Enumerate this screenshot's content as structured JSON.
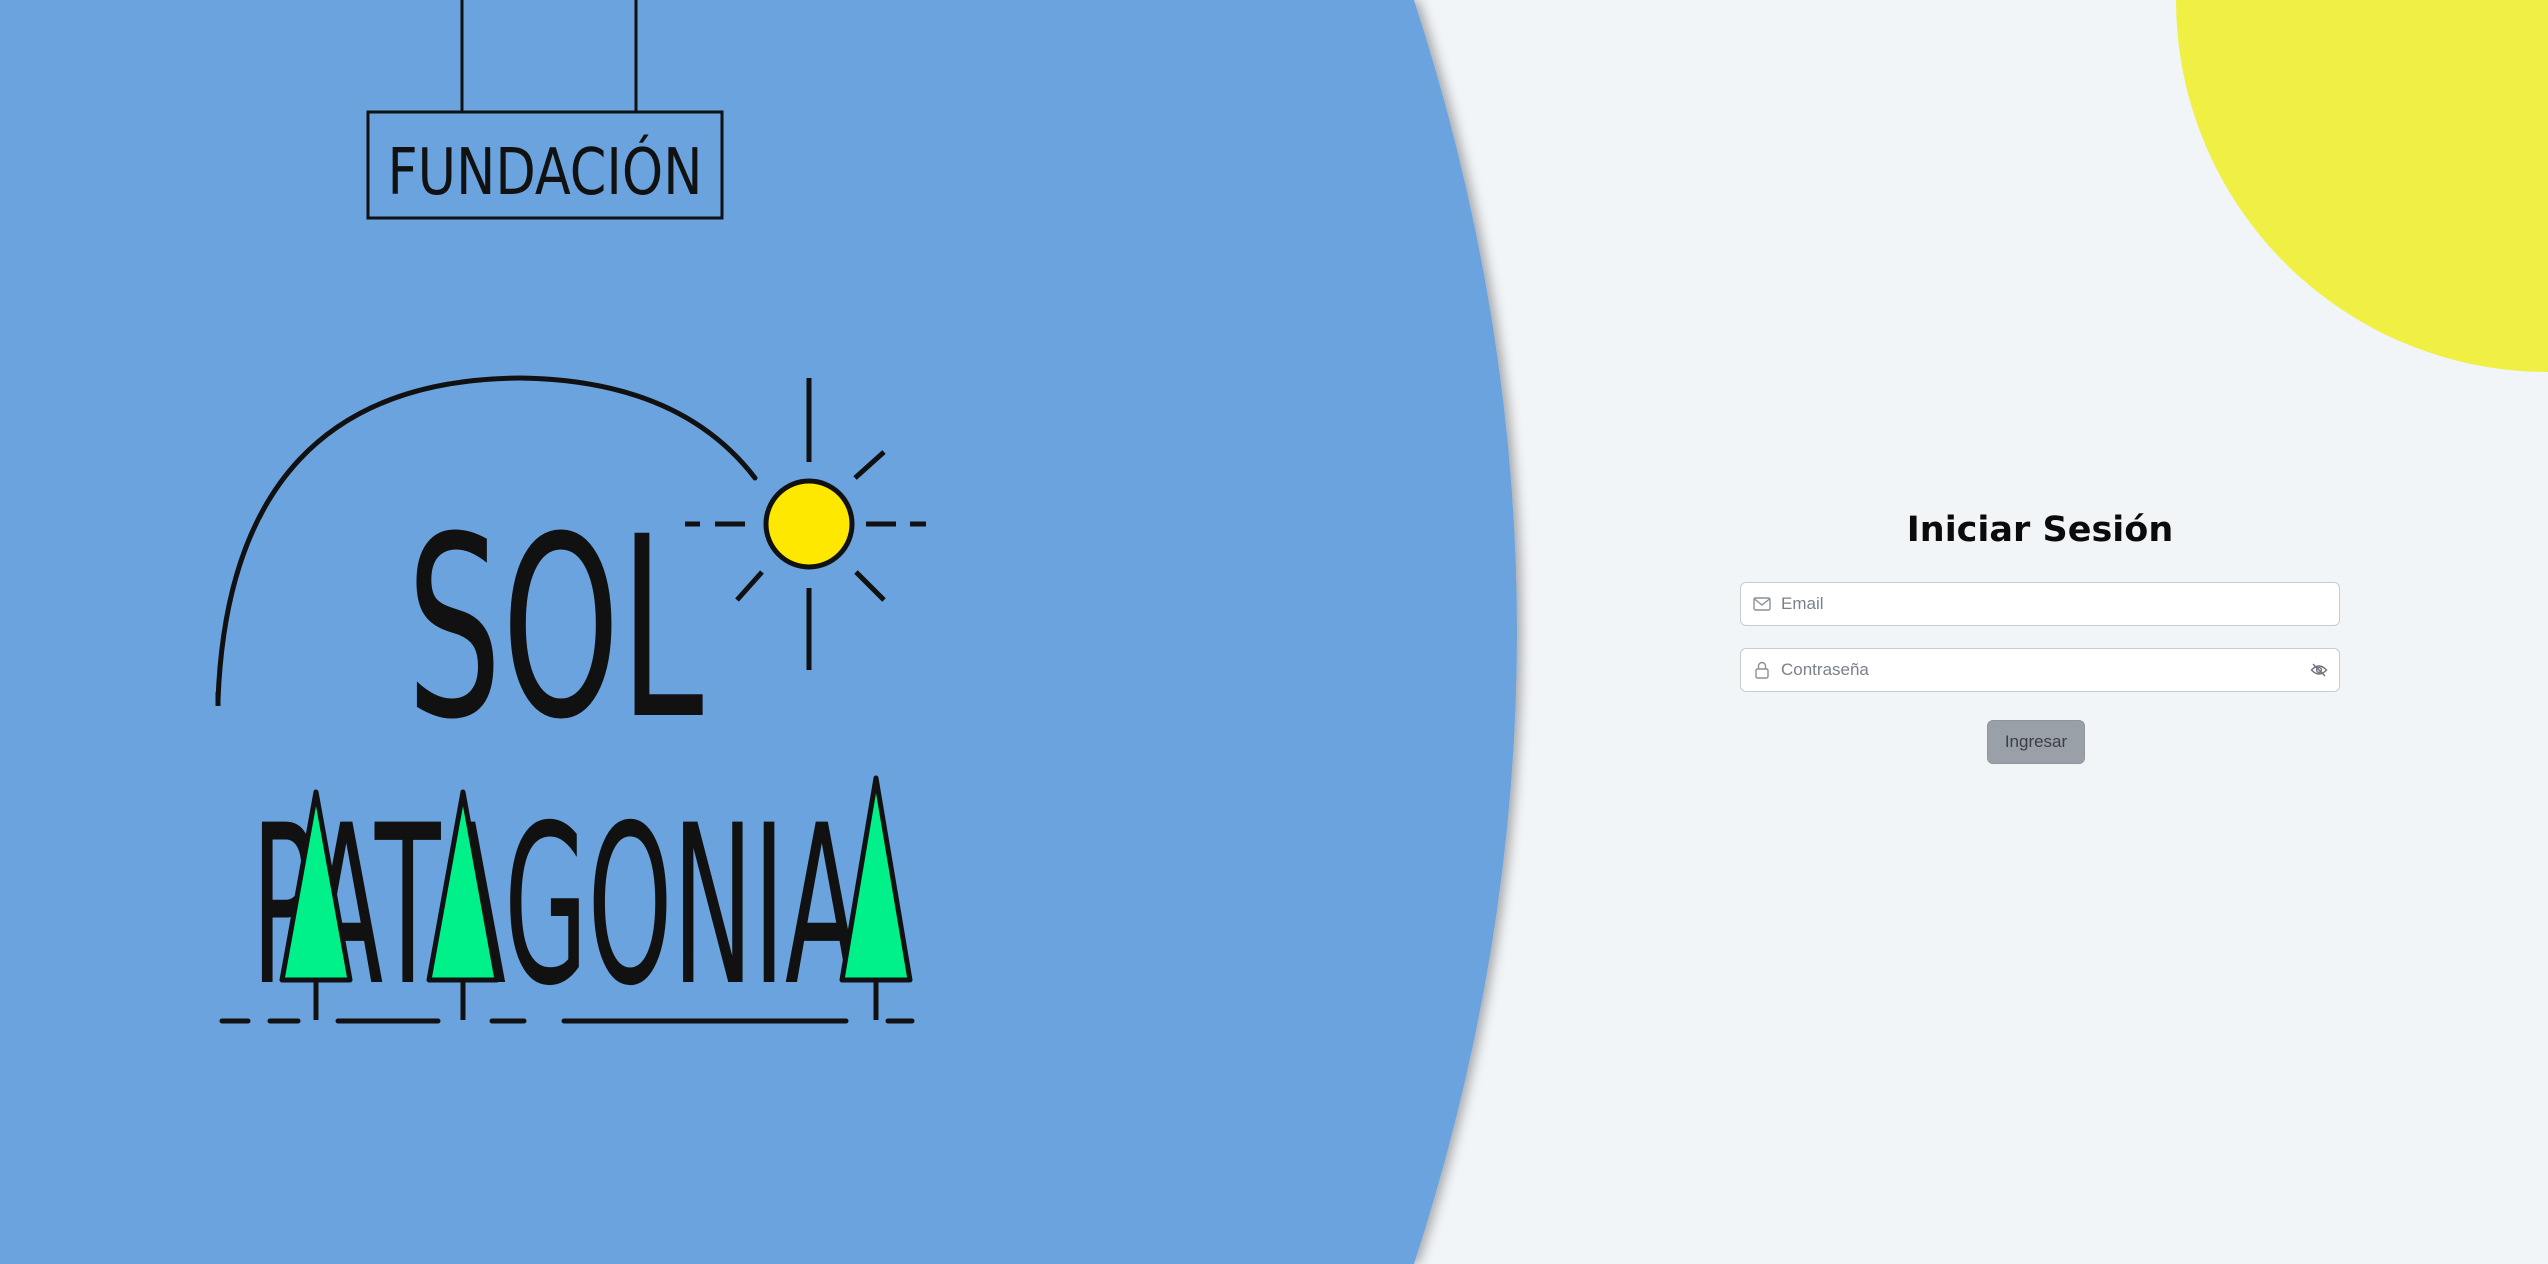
{
  "brand": {
    "line1": "FUNDACIÓN",
    "line2": "SOL",
    "line3": "PATAGONIA"
  },
  "colors": {
    "left_panel": "#6ba3de",
    "yellow_circle": "#eff043",
    "sun": "#ffe800",
    "trees": "#00f08a",
    "page_bg": "#f2f5f8",
    "button_bg": "#9aa0a8"
  },
  "login": {
    "title": "Iniciar Sesión",
    "email": {
      "placeholder": "Email",
      "value": "",
      "icon": "mail-icon"
    },
    "password": {
      "placeholder": "Contraseña",
      "value": "",
      "icon": "lock-icon",
      "toggle_icon": "eye-off-icon"
    },
    "submit_label": "Ingresar"
  }
}
